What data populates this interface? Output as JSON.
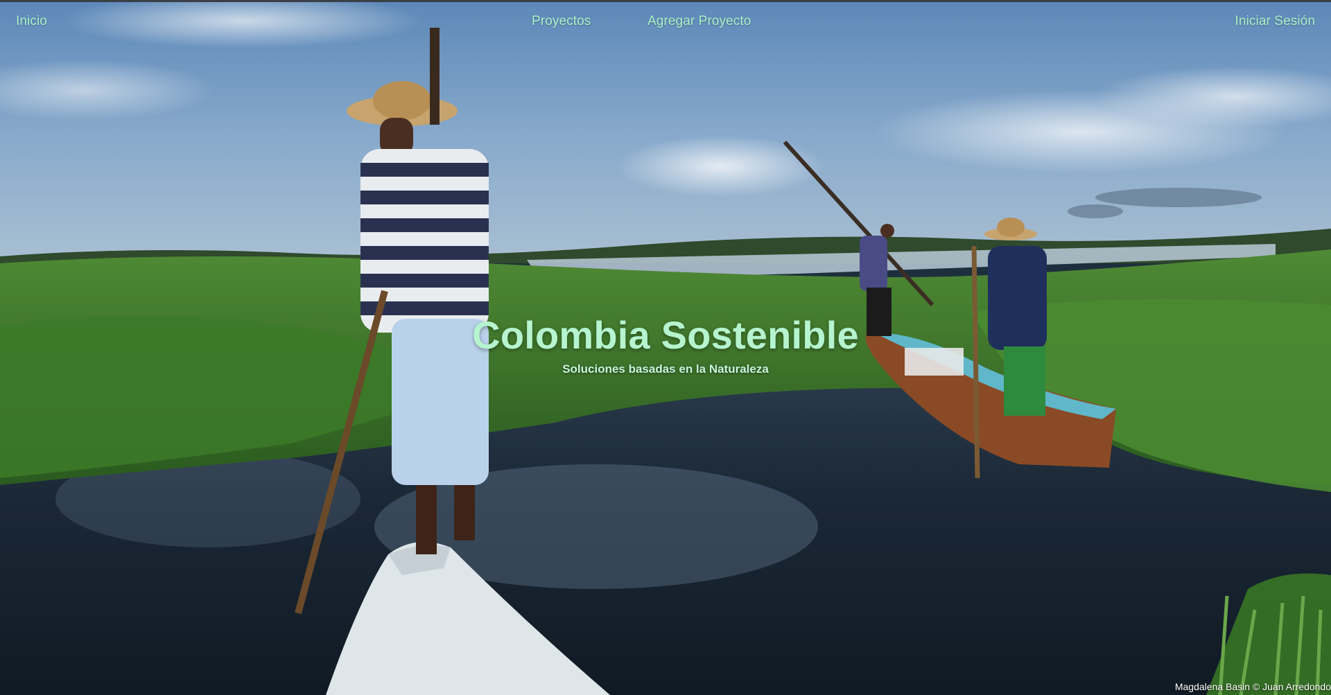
{
  "nav": {
    "home_label": "Inicio",
    "projects_label": "Proyectos",
    "add_project_label": "Agregar Proyecto",
    "login_label": "Iniciar Sesión"
  },
  "hero": {
    "title": "Colombia Sostenible",
    "subtitle": "Soluciones basadas en la Naturaleza",
    "photo_credit": "Magdalena Basin © Juan Arredondo"
  },
  "colors": {
    "nav_text": "#a9f1c7",
    "title_text": "#b5f4cf",
    "sky": "#6d93bd",
    "vegetation": "#3f7a2c",
    "water": "#1a2a3a"
  }
}
